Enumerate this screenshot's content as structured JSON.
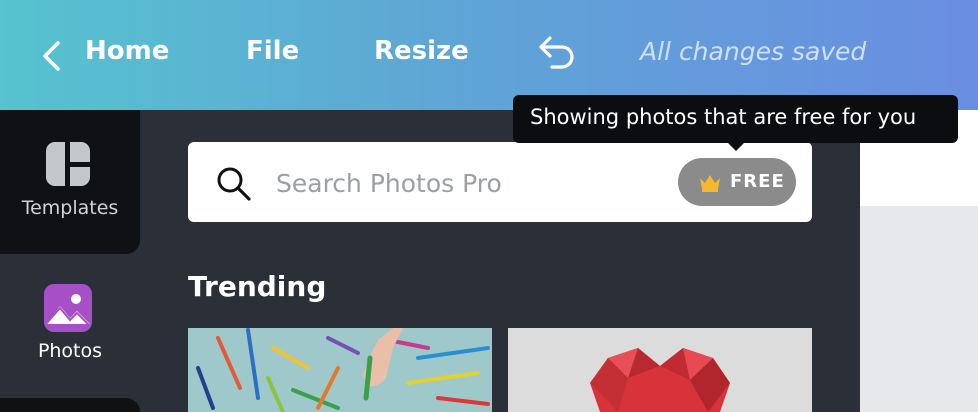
{
  "header": {
    "home_label": "Home",
    "file_label": "File",
    "resize_label": "Resize",
    "saved_status": "All changes saved"
  },
  "sidebar": {
    "items": [
      {
        "label": "Templates",
        "icon": "templates-icon"
      },
      {
        "label": "Photos",
        "icon": "photos-icon"
      }
    ]
  },
  "search": {
    "placeholder": "Search Photos Pro",
    "value": "",
    "badge_label": "FREE",
    "badge_icon": "crown-icon"
  },
  "tooltip": {
    "text": "Showing photos that are free for you"
  },
  "main": {
    "section_title": "Trending",
    "thumbnails": [
      {
        "name": "colored-pencils-photo"
      },
      {
        "name": "paper-heart-photo"
      }
    ]
  },
  "colors": {
    "header_gradient_start": "#56c3cf",
    "header_gradient_end": "#6a8ee2",
    "panel_bg": "#2a2f38",
    "photos_icon": "#a64fc7",
    "crown": "#f5b82e"
  }
}
